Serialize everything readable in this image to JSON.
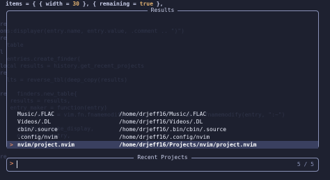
{
  "editor": {
    "top_line_prefix": "items = { { width = ",
    "top_line_num1": "30",
    "top_line_mid": " }, { remaining = ",
    "top_line_bool": "true",
    "top_line_suffix": " },",
    "background_lines": [
      "re",
      "ons:displayer(entry.name, entry.value, .comment .. \")\")",
      "re",
      "  table",
      "l",
      "  entries.create_finder(",
      "local results = history.get_recent_projects",
      "re",
      "  lts = reverse_tbl(deep_copy(results)",
      "",
      "re   finders.new_table{",
      "   results = results,",
      "   entry_maker = function(entry)",
      "     local value = vim.fn.fnamemodify(entry, \":t\")    vim.fn.fnamemodify(entry, \":~\")",
      "",
      "     display = make_display,",
      "     ordinal = entry,",
      "     value = entry",
      "",
      "re"
    ]
  },
  "results_panel": {
    "title": "Results",
    "items": [
      {
        "name": "Music/.FLAC",
        "path": "/home/drjeff16/Music/.FLAC",
        "selected": false
      },
      {
        "name": "Videos/.DL",
        "path": "/home/drjeff16/Videos/.DL",
        "selected": false
      },
      {
        "name": "cbin/.source",
        "path": "/home/drjeff16/.bin/cbin/.source",
        "selected": false
      },
      {
        "name": ".config/nvim",
        "path": "/home/drjeff16/.config/nvim",
        "selected": false
      },
      {
        "name": "nvim/project.nvim",
        "path": "/home/drjeff16/Projects/nvim/project.nvim",
        "selected": true
      }
    ],
    "selection_caret": ">"
  },
  "prompt_panel": {
    "title": "Recent Projects",
    "prefix": ">",
    "value": "",
    "count": "5 / 5"
  }
}
